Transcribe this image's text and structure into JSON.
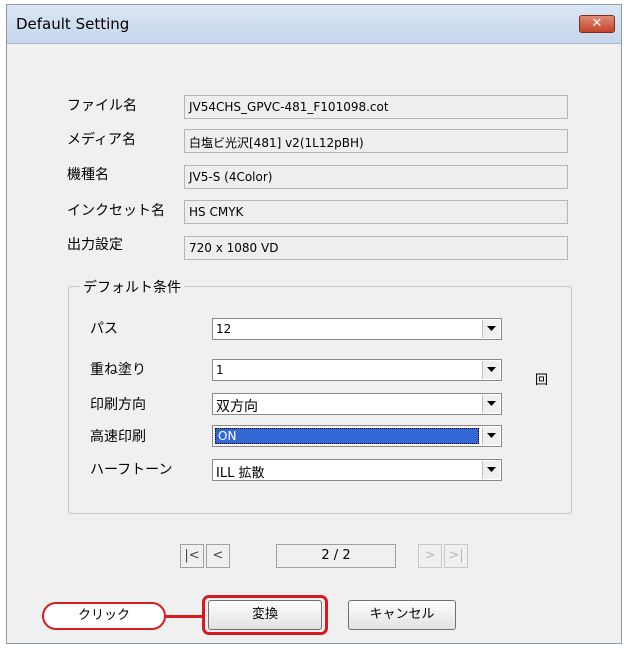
{
  "window": {
    "title": "Default Setting",
    "close_symbol": "✕"
  },
  "info": [
    {
      "label": "ファイル名",
      "value": "JV54CHS_GPVC-481_F101098.cot"
    },
    {
      "label": "メディア名",
      "value": "白塩ビ光沢[481] v2(1L12pBH)"
    },
    {
      "label": "機種名",
      "value": "JV5-S (4Color)"
    },
    {
      "label": "インクセット名",
      "value": "HS CMYK"
    },
    {
      "label": "出力設定",
      "value": "720 x 1080 VD"
    }
  ],
  "conditions": {
    "group_title": "デフォルト条件",
    "rows": [
      {
        "label": "パス",
        "value": "12"
      },
      {
        "label": "重ね塗り",
        "value": "1"
      },
      {
        "label": "印刷方向",
        "value": "双方向"
      },
      {
        "label": "高速印刷",
        "value": "ON"
      },
      {
        "label": "ハーフトーン",
        "value": "ILL 拡散"
      }
    ],
    "unit_icon": "回"
  },
  "pager": {
    "first": "|<",
    "prev": "<",
    "page": "2 / 2",
    "next": ">",
    "last": ">|"
  },
  "buttons": {
    "convert": "変換",
    "cancel": "キャンセル"
  },
  "annotation": {
    "callout": "クリック",
    "color": "#d81920"
  }
}
